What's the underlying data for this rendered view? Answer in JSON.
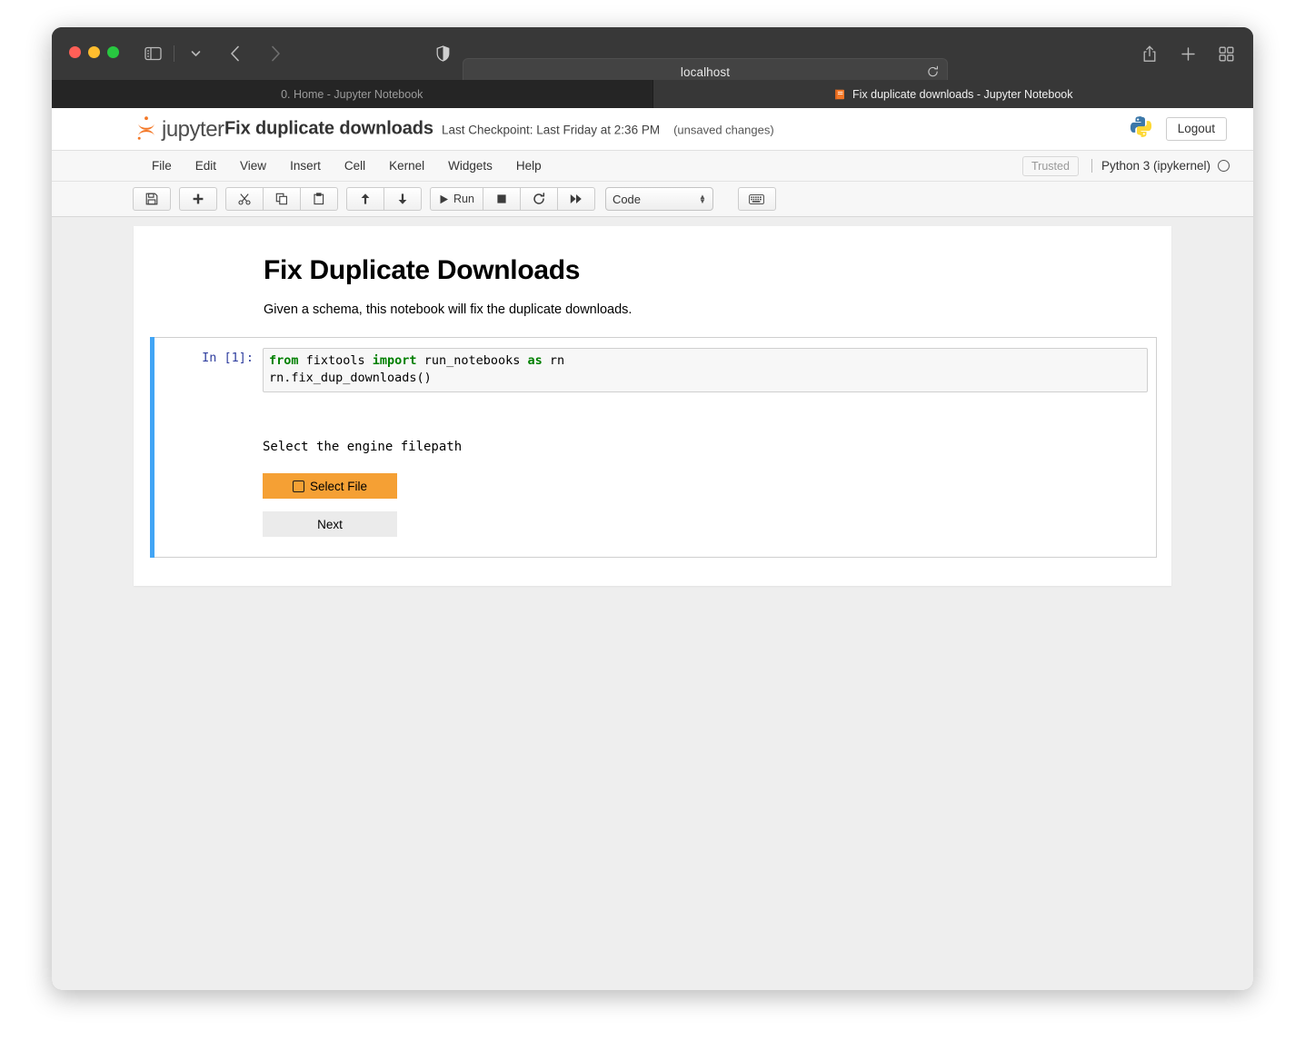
{
  "browser": {
    "url": "localhost",
    "icons": {
      "sidebar": "sidebar-toggle-icon",
      "chevron": "chevron-down-icon",
      "back": "back-arrow-icon",
      "forward": "forward-arrow-icon",
      "shield": "privacy-shield-icon",
      "reload": "reload-icon",
      "share": "share-icon",
      "new_tab": "plus-icon",
      "tab_overview": "tab-overview-icon"
    },
    "tabs": [
      {
        "title": "0. Home - Jupyter Notebook",
        "active": false,
        "favicon": ""
      },
      {
        "title": "Fix duplicate downloads - Jupyter Notebook",
        "active": true,
        "favicon": "jupyter-book-icon"
      }
    ]
  },
  "jupyter": {
    "logo_text": "jupyter",
    "notebook_name": "Fix duplicate downloads",
    "checkpoint": "Last Checkpoint: Last Friday at 2:36 PM",
    "modified": "(unsaved changes)",
    "logout_label": "Logout",
    "kernel_logo": "python-logo-icon",
    "menu": [
      "File",
      "Edit",
      "View",
      "Insert",
      "Cell",
      "Kernel",
      "Widgets",
      "Help"
    ],
    "trusted_label": "Trusted",
    "kernel_name": "Python 3 (ipykernel)",
    "kernel_status": "idle",
    "toolbar": {
      "save": "save-icon",
      "insert_below": "plus-icon",
      "cut": "scissors-icon",
      "copy": "copy-icon",
      "paste": "paste-icon",
      "move_up": "arrow-up-icon",
      "move_down": "arrow-down-icon",
      "run_label": "Run",
      "interrupt": "stop-square-icon",
      "restart": "restart-icon",
      "restart_run_all": "fast-forward-icon",
      "cell_type": "Code",
      "command_palette": "keyboard-icon"
    }
  },
  "notebook": {
    "markdown": {
      "heading": "Fix Duplicate Downloads",
      "paragraph": "Given a schema, this notebook will fix the duplicate downloads."
    },
    "cell": {
      "prompt": "In [1]:",
      "code": {
        "line1_kw1": "from",
        "line1_mod": " fixtools ",
        "line1_kw2": "import",
        "line1_name": " run_notebooks ",
        "line1_kw3": "as",
        "line1_alias": " rn",
        "line2": "rn.fix_dup_downloads()"
      },
      "output": {
        "prompt_text": "Select the engine filepath",
        "select_file_label": "Select File",
        "select_file_icon": "upload-square-icon",
        "next_label": "Next",
        "accent_color": "#f5a034"
      }
    }
  }
}
